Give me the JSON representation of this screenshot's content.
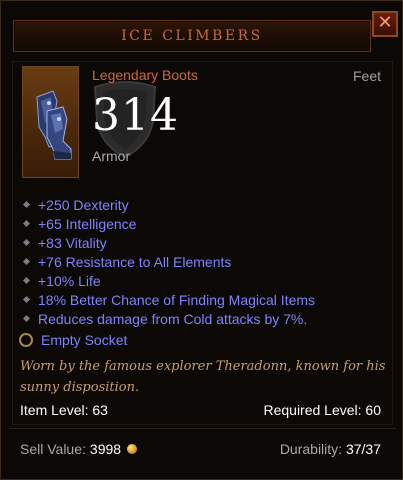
{
  "item": {
    "name": "ICE CLIMBERS",
    "type": "Legendary Boots",
    "slot": "Feet",
    "armor_value": "314",
    "armor_label": "Armor",
    "stats": [
      "+250 Dexterity",
      "+65 Intelligence",
      "+83 Vitality",
      "+76 Resistance to All Elements",
      "+10% Life",
      "18% Better Chance of Finding Magical Items",
      "Reduces damage from Cold attacks by 7%."
    ],
    "socket": "Empty Socket",
    "flavor": "Worn by the famous explorer Theradonn, known for his sunny disposition.",
    "item_level": "Item Level: 63",
    "required_level": "Required Level: 60",
    "sell_label": "Sell Value:",
    "sell_value": "3998",
    "durability_label": "Durability:",
    "durability_value": "37/37"
  },
  "ui": {
    "close_glyph": "✕"
  },
  "colors": {
    "title": "#c8693a",
    "legendary": "#d1693a",
    "magic": "#7f83ff",
    "flavor": "#c8a068"
  }
}
